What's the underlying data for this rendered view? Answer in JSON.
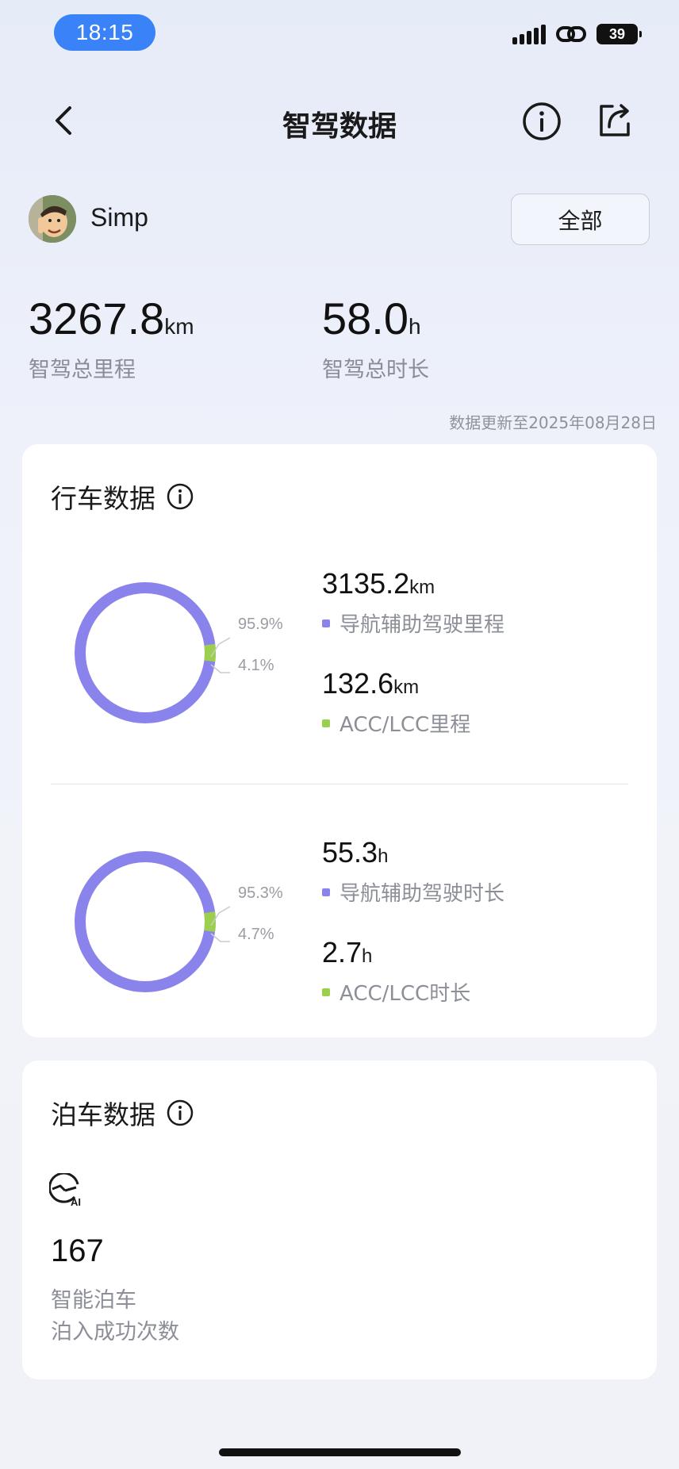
{
  "status_bar": {
    "time": "18:15",
    "battery": "39"
  },
  "header": {
    "title": "智驾数据"
  },
  "user": {
    "name": "Simp",
    "filter_label": "全部"
  },
  "totals": {
    "mileage_value": "3267.8",
    "mileage_unit": "km",
    "mileage_label": "智驾总里程",
    "duration_value": "58.0",
    "duration_unit": "h",
    "duration_label": "智驾总时长"
  },
  "updated_text": "数据更新至2025年08月28日",
  "colors": {
    "nav_assist": "#8b83ec",
    "acc_lcc": "#9dcf4f",
    "time_pill": "#3a82f7"
  },
  "driving": {
    "title": "行车数据",
    "mileage": {
      "nav_pct": "95.9%",
      "acc_pct": "4.1%",
      "nav_share": 0.959,
      "nav_value": "3135.2",
      "nav_unit": "km",
      "nav_label": "导航辅助驾驶里程",
      "acc_value": "132.6",
      "acc_unit": "km",
      "acc_label": "ACC/LCC里程"
    },
    "duration": {
      "nav_pct": "95.3%",
      "acc_pct": "4.7%",
      "nav_share": 0.953,
      "nav_value": "55.3",
      "nav_unit": "h",
      "nav_label": "导航辅助驾驶时长",
      "acc_value": "2.7",
      "acc_unit": "h",
      "acc_label": "ACC/LCC时长"
    }
  },
  "parking": {
    "title": "泊车数据",
    "count": "167",
    "label1": "智能泊车",
    "label2": "泊入成功次数"
  }
}
